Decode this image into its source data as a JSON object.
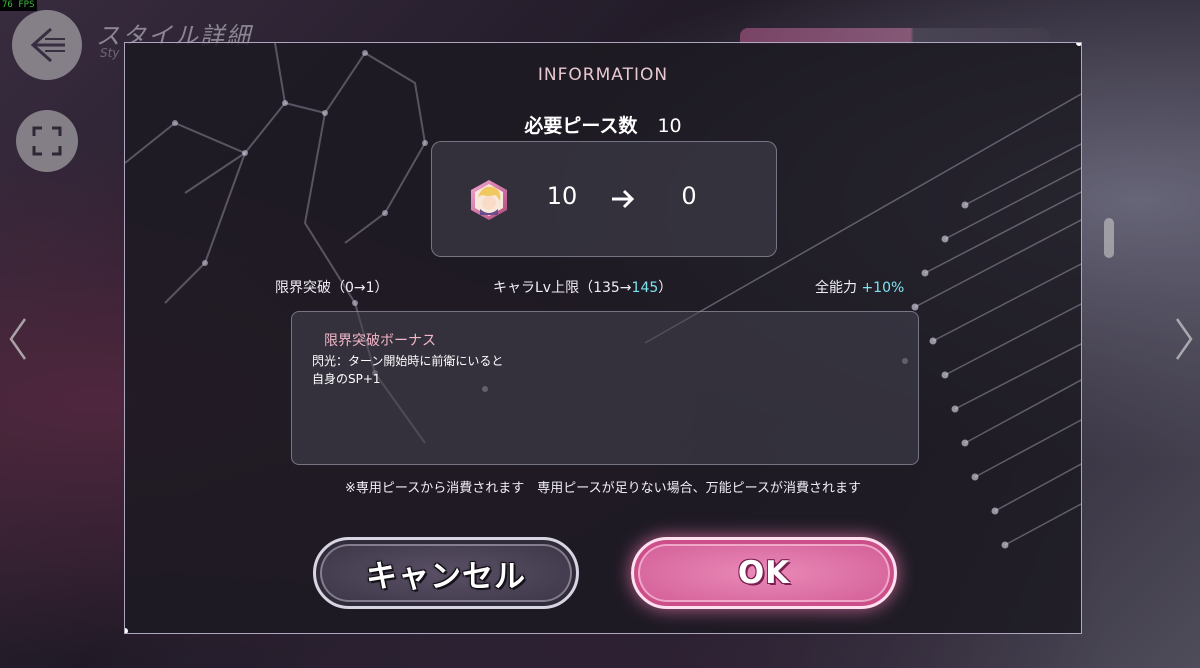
{
  "fps": "76 FPS",
  "header": {
    "title": "スタイル詳細",
    "subtitle": "Sty"
  },
  "modal": {
    "title": "INFORMATION",
    "required_label": "必要ピース数",
    "required_value": "10",
    "piece": {
      "from": "10",
      "to": "0",
      "icon": "character-piece-icon"
    },
    "stats": [
      {
        "label": "限界突破（0→1）",
        "highlight": ""
      },
      {
        "label": "キャラLv上限（135→",
        "highlight": "145",
        "suffix": "）"
      },
      {
        "label": "全能力 ",
        "highlight": "+10%"
      }
    ],
    "bonus": {
      "title": "限界突破ボーナス",
      "lines": [
        "閃光：ターン開始時に前衛にいると",
        "自身のSP+1"
      ]
    },
    "note": "※専用ピースから消費されます　専用ピースが足りない場合、万能ピースが消費されます",
    "cancel_label": "キャンセル",
    "ok_label": "OK"
  },
  "colors": {
    "accent_pink": "#d05a94",
    "highlight_cyan": "#7fe3f0",
    "bonus_title": "#f4b8c8",
    "info_title": "#e8c8d0"
  }
}
